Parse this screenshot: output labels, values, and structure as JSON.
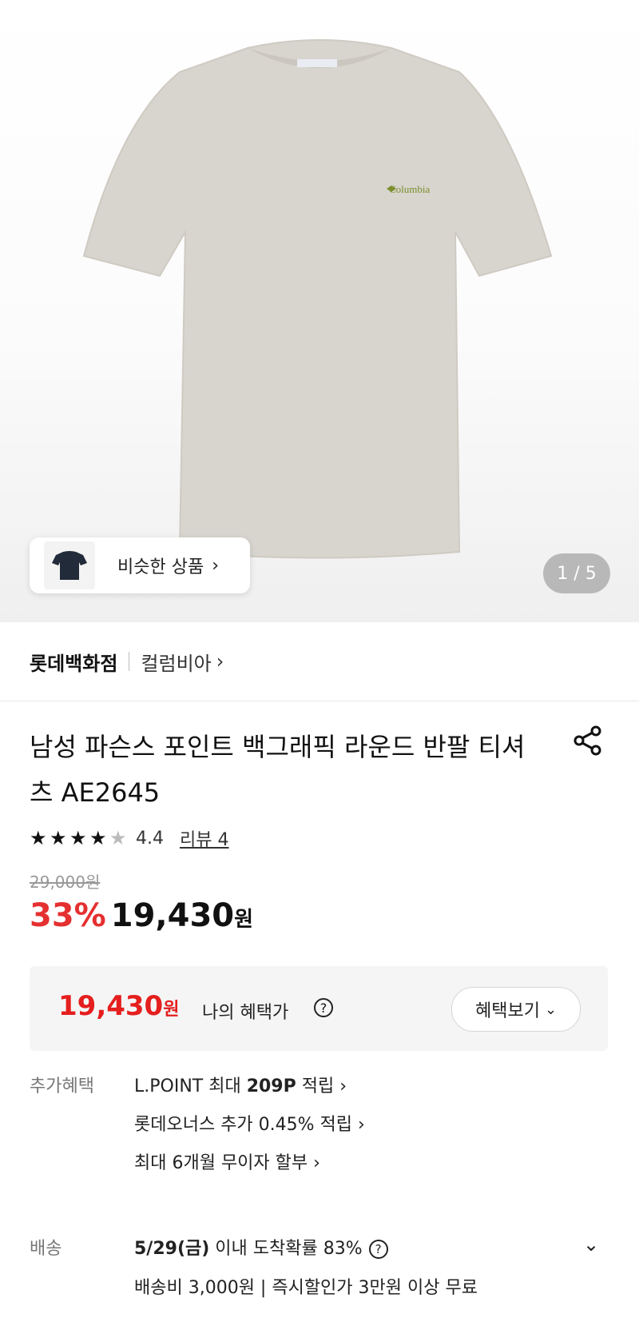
{
  "gallery": {
    "similar_label": "비슷한 상품",
    "counter": "1 / 5",
    "logo_text": "Columbia"
  },
  "store": {
    "name": "롯데백화점",
    "brand": "컬럼비아"
  },
  "product": {
    "title": "남성 파슨스 포인트 백그래픽 라운드 반팔 티셔츠 AE2645",
    "rating": "4.4",
    "review_label": "리뷰 4",
    "original_price": "29,000원",
    "discount": "33%",
    "price": "19,430",
    "currency": "원"
  },
  "benefit": {
    "price": "19,430",
    "currency": "원",
    "label": "나의 혜택가",
    "button": "혜택보기"
  },
  "extra": {
    "label": "추가혜택",
    "line1_prefix": "L.POINT 최대 ",
    "line1_bold": "209P",
    "line1_suffix": " 적립",
    "line2": "롯데오너스 추가 0.45% 적립",
    "line3": "최대 6개월 무이자 할부"
  },
  "shipping": {
    "label": "배송",
    "date": "5/29(금)",
    "rest": " 이내 도착확률 83%",
    "fee": "배송비 3,000원 | 즉시할인가 3만원 이상 무료"
  },
  "colors": {
    "accent_red": "#e51e1e",
    "discount_red": "#e53030"
  }
}
